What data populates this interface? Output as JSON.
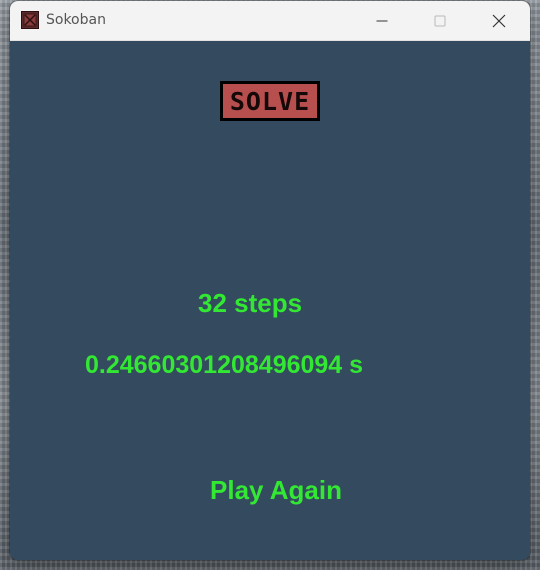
{
  "window": {
    "title": "Sokoban",
    "icon": "sokoban-app-icon"
  },
  "controls": {
    "minimize_icon": "minimize-icon",
    "maximize_icon": "maximize-icon",
    "close_icon": "close-icon"
  },
  "game": {
    "solve_label": "SOLVE",
    "steps_text": "32 steps",
    "time_text": "0.24660301208496094 s",
    "play_again_label": "Play Again"
  },
  "colors": {
    "background": "#344a5f",
    "result_text": "#33e833",
    "solve_button": "#b84f4f"
  }
}
